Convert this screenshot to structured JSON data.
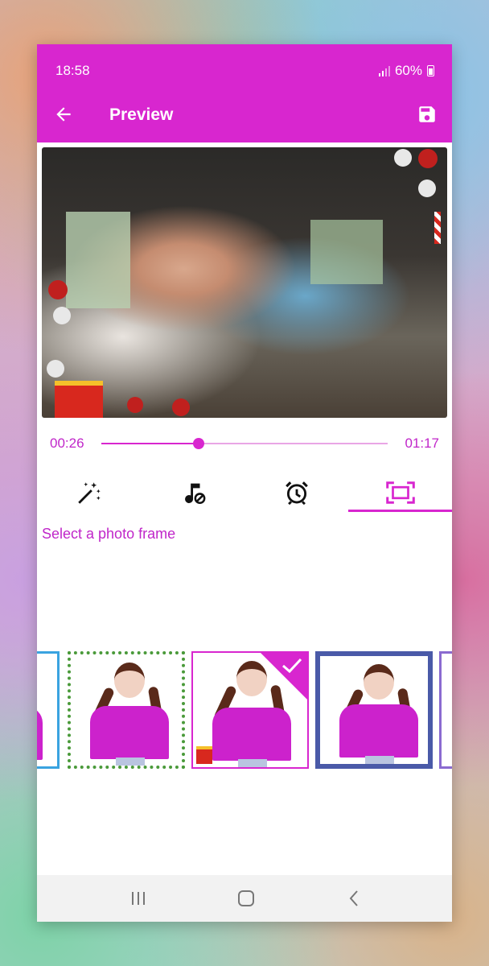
{
  "status_bar": {
    "time": "18:58",
    "battery": "60%"
  },
  "toolbar": {
    "title": "Preview",
    "back_icon": "arrow-left-icon",
    "save_icon": "save-icon"
  },
  "player": {
    "current_time": "00:26",
    "total_time": "01:17",
    "progress": 0.34
  },
  "tabs": [
    {
      "icon": "magic-wand-icon",
      "selected": false
    },
    {
      "icon": "music-off-icon",
      "selected": false
    },
    {
      "icon": "alarm-clock-icon",
      "selected": false
    },
    {
      "icon": "frame-icon",
      "selected": true
    }
  ],
  "frames_section": {
    "hint": "Select a photo frame"
  },
  "frames": [
    {
      "style": "blue-border",
      "selected": false
    },
    {
      "style": "green-vines",
      "selected": false
    },
    {
      "style": "christmas",
      "selected": true
    },
    {
      "style": "blue-grunge",
      "selected": false
    },
    {
      "style": "purple-floral",
      "selected": false
    }
  ],
  "colors": {
    "accent": "#d826cf",
    "accent_text": "#c026c9",
    "nav_bar": "#f2f2f2"
  },
  "nav_bar": {
    "items": [
      "recent-apps-icon",
      "home-icon",
      "back-icon"
    ]
  }
}
